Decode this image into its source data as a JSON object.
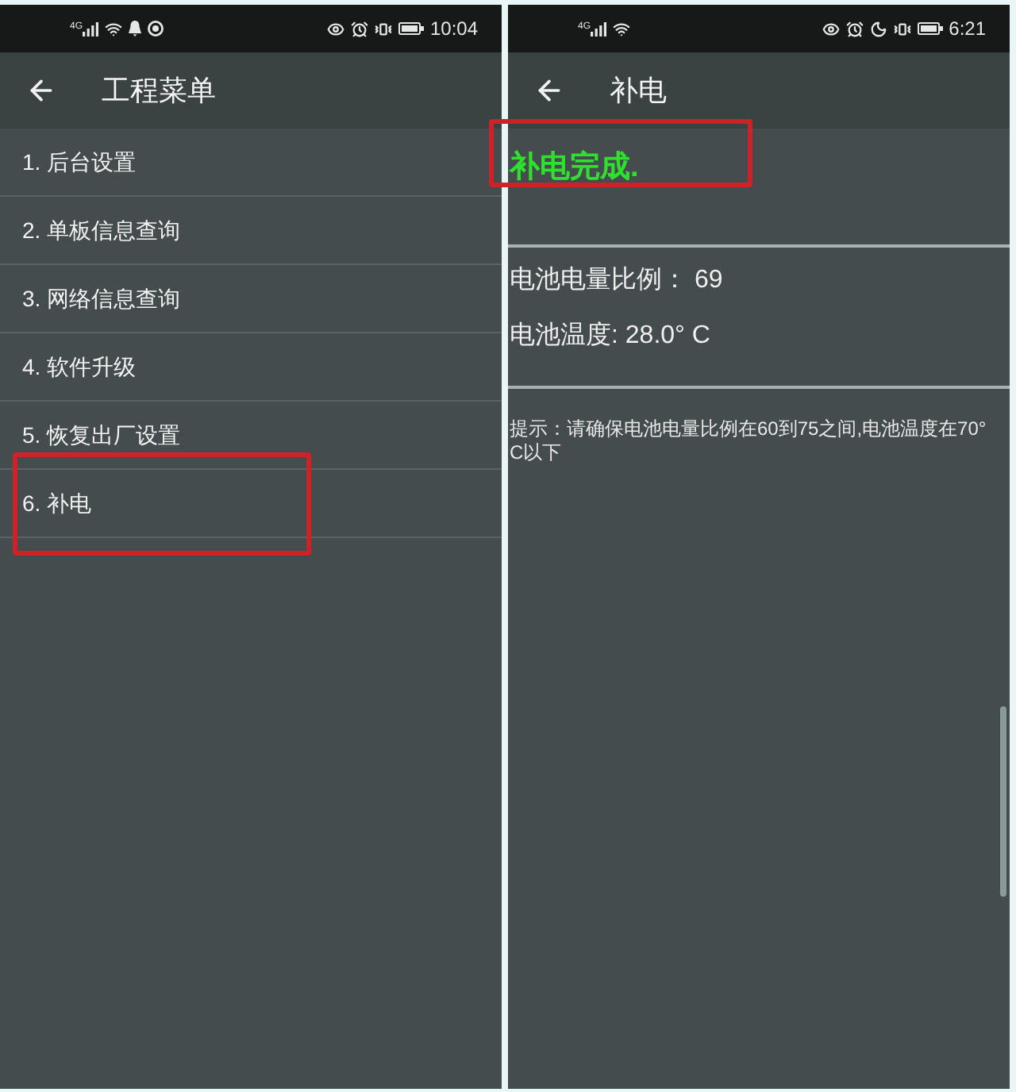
{
  "screens": [
    {
      "kind": "menu",
      "status_bar": {
        "network": "4G",
        "notifications": [
          {
            "kind": "bell"
          },
          {
            "kind": "ring"
          }
        ],
        "do_not_disturb": false,
        "time": "10:04"
      },
      "header": {
        "title": "工程菜单"
      },
      "items": [
        {
          "label": "1. 后台设置",
          "highlighted": false
        },
        {
          "label": "2. 单板信息查询",
          "highlighted": false
        },
        {
          "label": "3. 网络信息查询",
          "highlighted": false
        },
        {
          "label": "4. 软件升级",
          "highlighted": false
        },
        {
          "label": "5. 恢复出厂设置",
          "highlighted": false
        },
        {
          "label": "6. 补电",
          "highlighted": true
        }
      ]
    },
    {
      "kind": "detail",
      "status_bar": {
        "network": "4G",
        "do_not_disturb": true,
        "time": "6:21"
      },
      "header": {
        "title": "补电"
      },
      "result": {
        "text": "补电完成.",
        "highlighted": true
      },
      "readings": [
        "电池电量比例： 69",
        "电池温度: 28.0° C"
      ],
      "hint": "提示：请确保电池电量比例在60到75之间,电池温度在70°C以下"
    }
  ]
}
